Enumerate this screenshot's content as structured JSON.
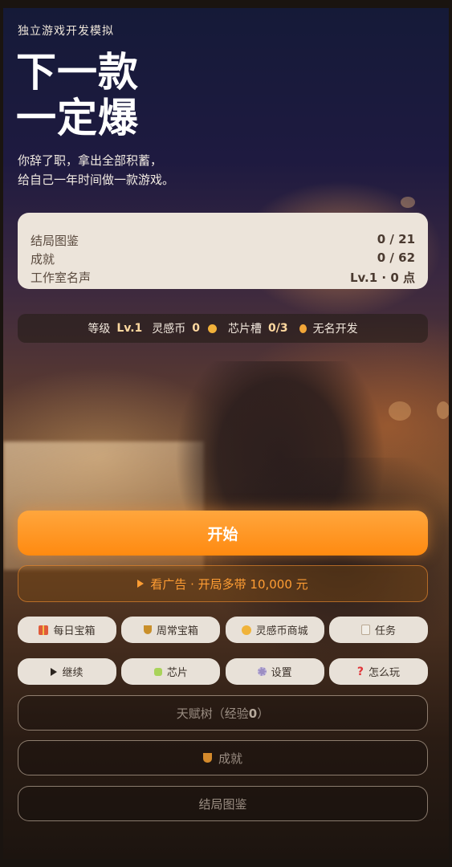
{
  "header": {
    "tagline": "独立游戏开发模拟",
    "title_line1": "下一款",
    "title_line2": "一定爆",
    "intro_line1": "你辞了职，拿出全部积蓄，",
    "intro_line2": "给自己一年时间做一款游戏。"
  },
  "stats": [
    {
      "label": "结局图鉴",
      "value": "0 / 21"
    },
    {
      "label": "成就",
      "value": "0 / 62"
    },
    {
      "label": "工作室名声",
      "value": "Lv.1 · 0 点"
    }
  ],
  "status_bar": {
    "level_label": "等级",
    "level_value": "Lv.1",
    "coin_label": "灵感币",
    "coin_value": "0",
    "chip_label": "芯片槽",
    "chip_value": "0/3",
    "rank_label": "无名开发",
    "coin_icon": "coin-icon",
    "rank_icon": "medal-icon"
  },
  "actions": {
    "start": "开始",
    "ad": "看广告 · 开局多带 10,000 元"
  },
  "pills_row1": [
    {
      "label": "每日宝箱",
      "icon": "gift-icon"
    },
    {
      "label": "周常宝箱",
      "icon": "trophy-icon"
    },
    {
      "label": "灵感币商城",
      "icon": "coin-icon"
    },
    {
      "label": "任务",
      "icon": "clipboard-icon"
    }
  ],
  "pills_row2": [
    {
      "label": "继续",
      "icon": "play-icon"
    },
    {
      "label": "芯片",
      "icon": "chip-icon"
    },
    {
      "label": "设置",
      "icon": "gear-icon"
    },
    {
      "label": "怎么玩",
      "icon": "question-icon"
    }
  ],
  "talent_tree": {
    "label": "天赋树（经验",
    "xp": "0",
    "close": "）"
  },
  "achievements_label": "成就",
  "endings_label": "结局图鉴",
  "colors": {
    "accent": "#ff8a10",
    "card_bg": "#ece4da",
    "ad_text": "#ff9d33"
  }
}
